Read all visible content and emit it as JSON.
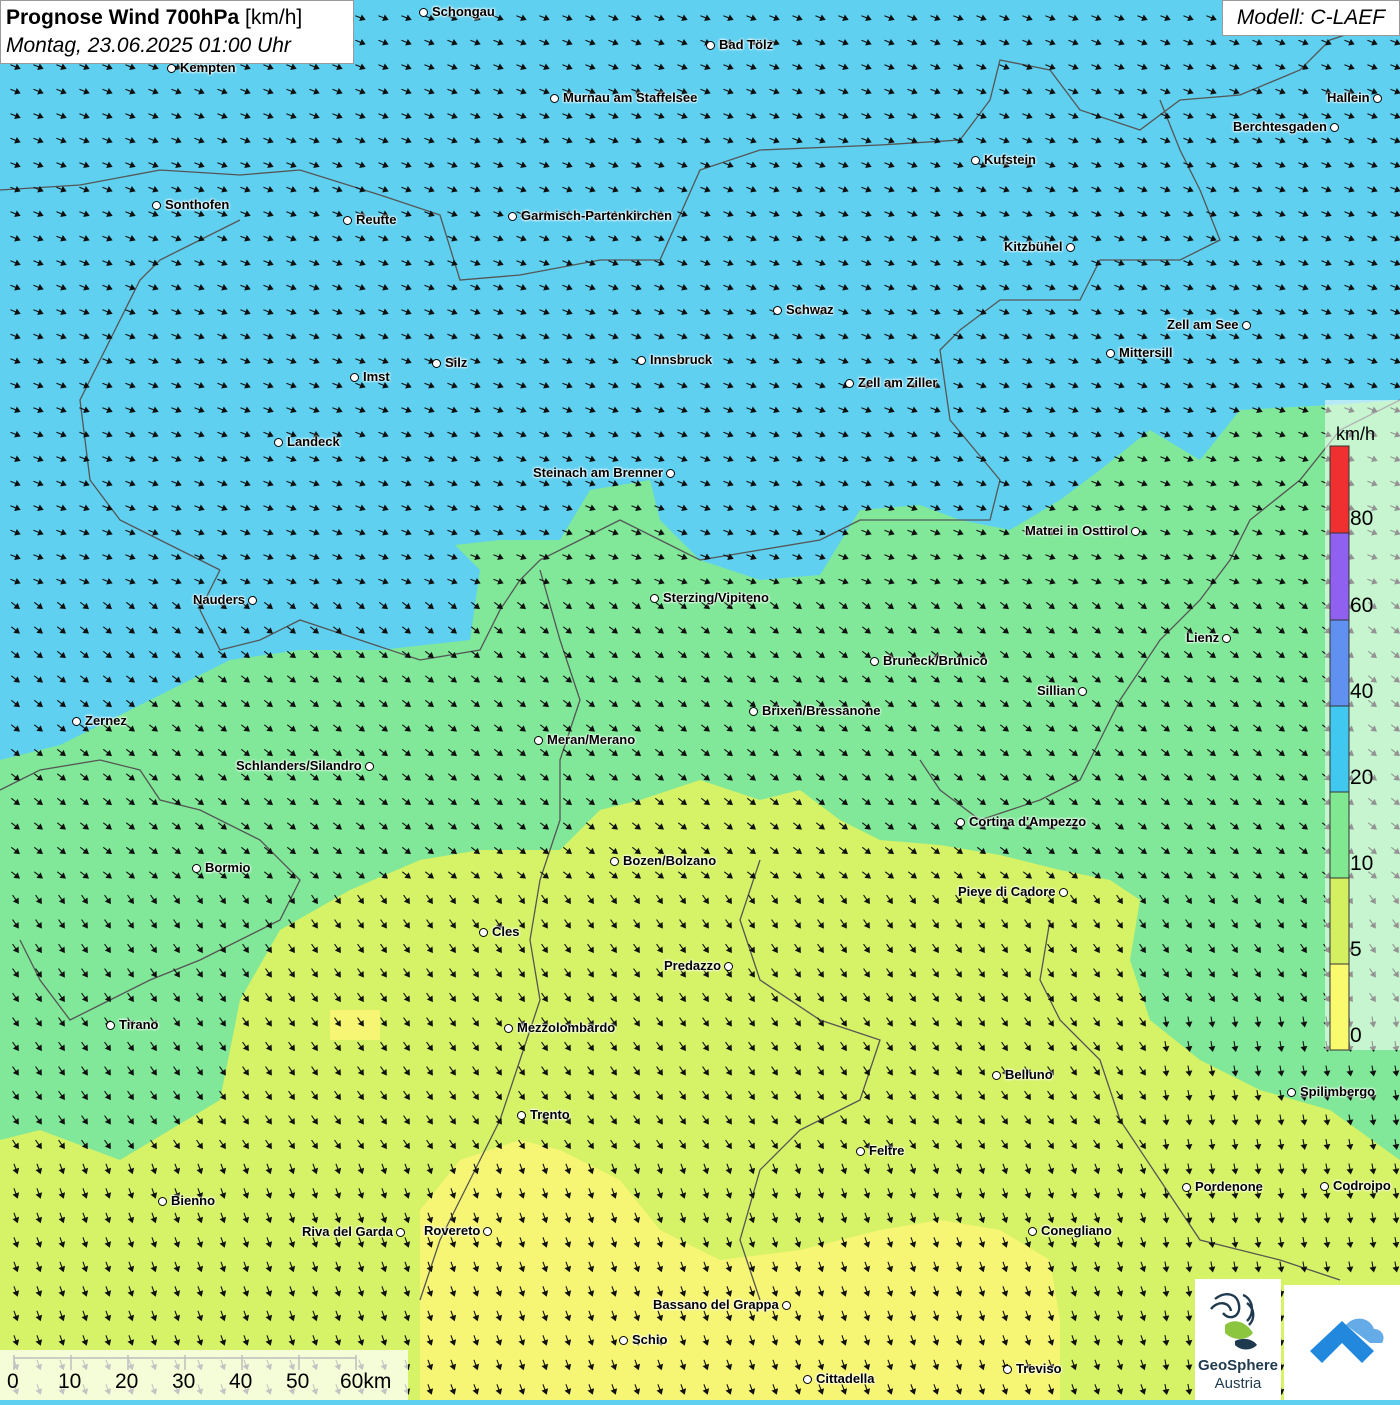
{
  "map": {
    "title_bold": "Prognose Wind 700hPa",
    "title_unit": "[km/h]",
    "datetime": "Montag, 23.06.2025 01:00 Uhr",
    "model": "Modell: C-LAEF",
    "colors": {
      "0": "#fafa6e",
      "5": "#d4f060",
      "10": "#80e890",
      "20": "#40c8f0",
      "40": "#6090f0",
      "60": "#9060f0",
      "80": "#f03030"
    }
  },
  "legend": {
    "unit": "km/h",
    "labels": [
      "80",
      "60",
      "40",
      "20",
      "10",
      "5",
      "0"
    ]
  },
  "scale_bar": {
    "labels": [
      "0",
      "10",
      "20",
      "30",
      "40",
      "50",
      "60km"
    ]
  },
  "logo": {
    "word1": "GeoSphere",
    "word2": "Austria"
  },
  "cities": [
    {
      "name": "Schongau"
    },
    {
      "name": "Bad Tölz"
    },
    {
      "name": "Kempten"
    },
    {
      "name": "Murnau am Staffelsee"
    },
    {
      "name": "Hallein"
    },
    {
      "name": "Berchtesgaden"
    },
    {
      "name": "Kufstein"
    },
    {
      "name": "Sonthofen"
    },
    {
      "name": "Reutte"
    },
    {
      "name": "Garmisch-Partenkirchen"
    },
    {
      "name": "Kitzbühel"
    },
    {
      "name": "Schwaz"
    },
    {
      "name": "Zell am See"
    },
    {
      "name": "Mittersill"
    },
    {
      "name": "Innsbruck"
    },
    {
      "name": "Silz"
    },
    {
      "name": "Imst"
    },
    {
      "name": "Zell am Ziller"
    },
    {
      "name": "Landeck"
    },
    {
      "name": "Steinach am Brenner"
    },
    {
      "name": "Matrei in Osttirol"
    },
    {
      "name": "Nauders"
    },
    {
      "name": "Sterzing/Vipiteno"
    },
    {
      "name": "Lienz"
    },
    {
      "name": "Bruneck/Brunico"
    },
    {
      "name": "Sillian"
    },
    {
      "name": "Zernez"
    },
    {
      "name": "Brixen/Bressanone"
    },
    {
      "name": "Meran/Merano"
    },
    {
      "name": "Schlanders/Silandro"
    },
    {
      "name": "Cortina d'Ampezzo"
    },
    {
      "name": "Bozen/Bolzano"
    },
    {
      "name": "Bormio"
    },
    {
      "name": "Pieve di Cadore"
    },
    {
      "name": "Cles"
    },
    {
      "name": "Predazzo"
    },
    {
      "name": "Tirano"
    },
    {
      "name": "Mezzolombardo"
    },
    {
      "name": "Belluno"
    },
    {
      "name": "Spilimbergo"
    },
    {
      "name": "Trento"
    },
    {
      "name": "Feltre"
    },
    {
      "name": "Pordenone"
    },
    {
      "name": "Codroipo"
    },
    {
      "name": "Bienno"
    },
    {
      "name": "Riva del Garda"
    },
    {
      "name": "Rovereto"
    },
    {
      "name": "Conegliano"
    },
    {
      "name": "Bassano del Grappa"
    },
    {
      "name": "Schio"
    },
    {
      "name": "Treviso"
    },
    {
      "name": "Cittadella"
    }
  ]
}
